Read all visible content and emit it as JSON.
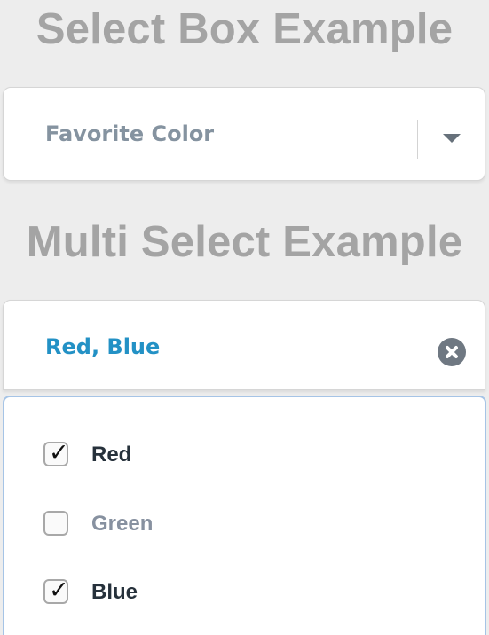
{
  "select_section": {
    "title": "Select Box Example",
    "value": "Favorite Color"
  },
  "multi_section": {
    "title": "Multi Select Example",
    "value": "Red, Blue"
  },
  "options": [
    {
      "label": "Red",
      "checked": true
    },
    {
      "label": "Green",
      "checked": false
    },
    {
      "label": "Blue",
      "checked": true
    }
  ],
  "icons": {
    "dropdown": "chevron-down-icon",
    "clear": "clear-icon",
    "check": "checkmark-icon"
  },
  "colors": {
    "heading": "#a4a4a4",
    "placeholder": "#8593a0",
    "selected_value": "#2391c5",
    "dropdown_border": "#a6c4e6"
  },
  "glyphs": {
    "check": "✓"
  }
}
